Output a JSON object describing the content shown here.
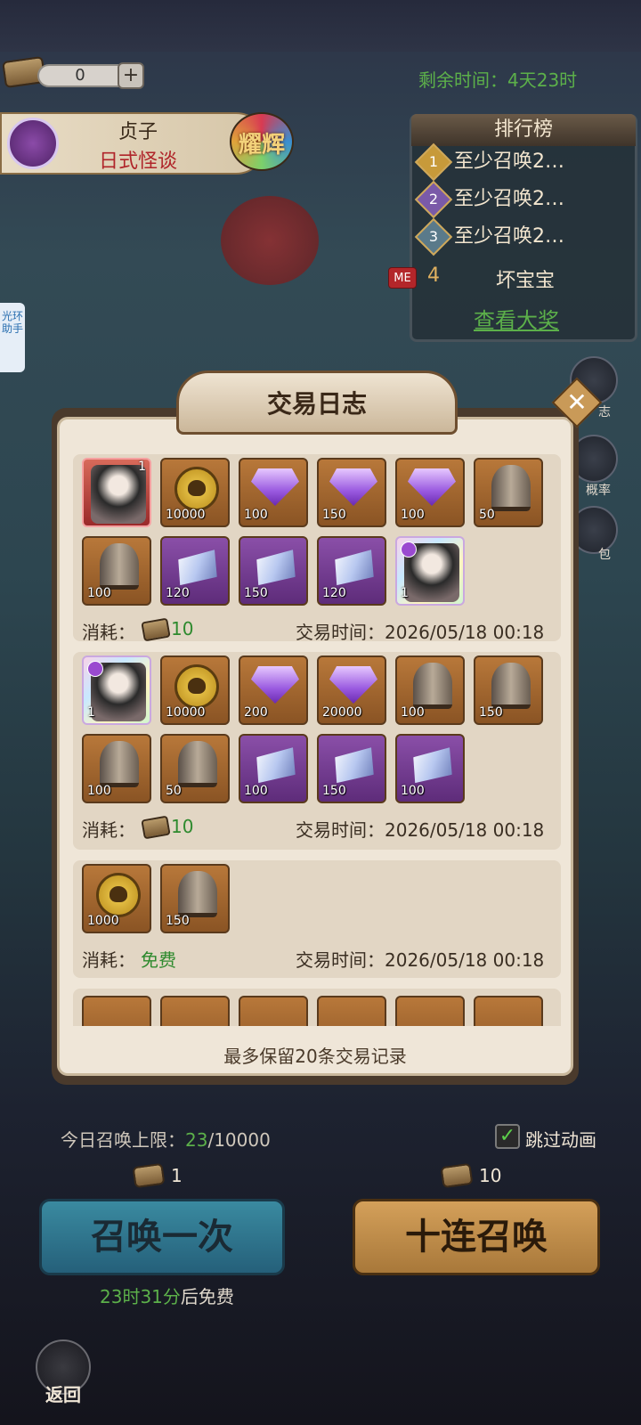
{
  "top": {
    "ticket_count": "0",
    "plus": "+",
    "remaining_time": "剩余时间：4天23时"
  },
  "banner": {
    "name": "贞子",
    "subtitle": "日式怪谈",
    "badge": "耀辉"
  },
  "ranking": {
    "title": "排行榜",
    "rows": [
      {
        "rank": "1",
        "text": "至少召唤2…",
        "color": "#c79a3a"
      },
      {
        "rank": "2",
        "text": "至少召唤2…",
        "color": "#7a5aa8"
      },
      {
        "rank": "3",
        "text": "至少召唤2…",
        "color": "#5a7a8a"
      }
    ],
    "me_badge": "ME",
    "me_rank": "4",
    "me_name": "坏宝宝",
    "view_prize": "查看大奖"
  },
  "helper": {
    "label": "光环助手"
  },
  "side": {
    "rate_label": "概率",
    "pack_label": "包",
    "log_label": "志"
  },
  "dialog": {
    "title": "交易日志",
    "close": "✕",
    "cost_label": "消耗：",
    "time_label": "交易时间：",
    "footer": "最多保留20条交易记录",
    "records": [
      {
        "cost": "10",
        "time": "2026/05/18 00:18",
        "items": [
          {
            "kind": "hero-red",
            "qty": "1"
          },
          {
            "kind": "coin",
            "qty": "10000"
          },
          {
            "kind": "gem",
            "qty": "100"
          },
          {
            "kind": "gem",
            "qty": "150"
          },
          {
            "kind": "gem",
            "qty": "100"
          },
          {
            "kind": "bell",
            "qty": "50"
          },
          {
            "kind": "bell",
            "qty": "100"
          },
          {
            "kind": "crystal",
            "qty": "120"
          },
          {
            "kind": "crystal",
            "qty": "150"
          },
          {
            "kind": "crystal",
            "qty": "120"
          },
          {
            "kind": "hero-rainbow",
            "qty": "1"
          }
        ]
      },
      {
        "cost": "10",
        "time": "2026/05/18 00:18",
        "items": [
          {
            "kind": "hero-rainbow",
            "qty": "1"
          },
          {
            "kind": "coin",
            "qty": "10000"
          },
          {
            "kind": "gem",
            "qty": "200"
          },
          {
            "kind": "gem",
            "qty": "20000"
          },
          {
            "kind": "bell",
            "qty": "100"
          },
          {
            "kind": "bell",
            "qty": "150"
          },
          {
            "kind": "bell",
            "qty": "100"
          },
          {
            "kind": "bell",
            "qty": "50"
          },
          {
            "kind": "crystal",
            "qty": "100"
          },
          {
            "kind": "crystal",
            "qty": "150"
          },
          {
            "kind": "crystal",
            "qty": "100"
          }
        ]
      },
      {
        "cost": "免费",
        "time": "2026/05/18 00:18",
        "items": [
          {
            "kind": "coin",
            "qty": "1000"
          },
          {
            "kind": "bell",
            "qty": "150"
          }
        ]
      }
    ]
  },
  "bottom": {
    "limit_prefix": "今日召唤上限：",
    "limit_used": "23",
    "limit_total": "/10000",
    "skip_label": "跳过动画",
    "skip_check": "✓",
    "once_cost": "1",
    "ten_cost": "10",
    "once_label": "召唤一次",
    "ten_label": "十连召唤",
    "free_time": "23时31分",
    "free_suffix": "后免费",
    "back_label": "返回"
  }
}
